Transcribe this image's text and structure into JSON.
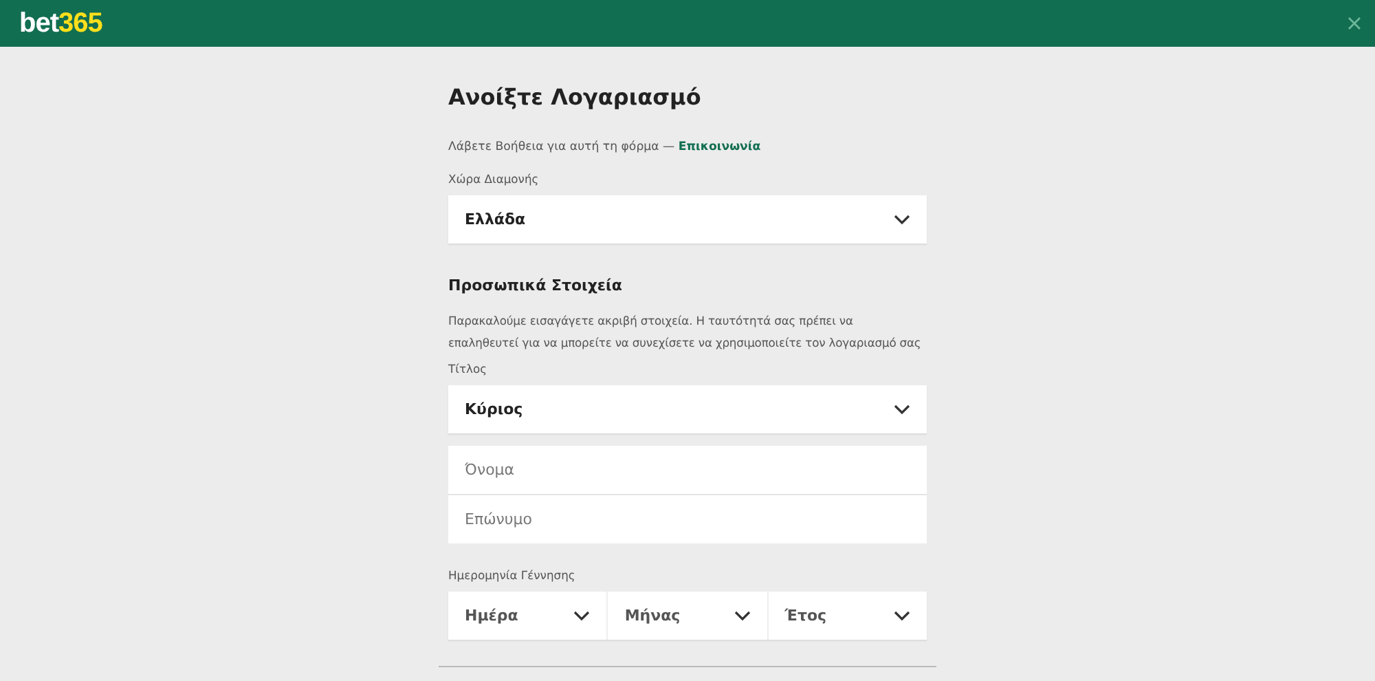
{
  "header": {
    "logo": {
      "text": "bet",
      "accent": "365"
    }
  },
  "form": {
    "title": "Ανοίξτε Λογαριασμό",
    "help": {
      "text": "Λάβετε Βοήθεια για αυτή τη φόρμα — ",
      "link": "Επικοινωνία"
    },
    "country": {
      "label": "Χώρα Διαμονής",
      "value": "Ελλάδα"
    },
    "section_title": "Προσωπικά Στοιχεία",
    "section_note": "Παρακαλούμε εισαγάγετε ακριβή στοιχεία. Η ταυτότητά σας πρέπει να επαληθευτεί για να μπορείτε να συνεχίσετε να χρησιμοποιείτε τον λογαριασμό σας",
    "title_select": {
      "label": "Τίτλος",
      "value": "Κύριος"
    },
    "name_fields": [
      {
        "placeholder": "Όνομα"
      },
      {
        "placeholder": "Επώνυμο"
      }
    ],
    "birth_date": {
      "label": "Ημερομηνία Γέννησης",
      "parts": [
        {
          "value": "Ημέρα"
        },
        {
          "value": "Μήνας"
        },
        {
          "value": "Έτος"
        }
      ]
    }
  }
}
